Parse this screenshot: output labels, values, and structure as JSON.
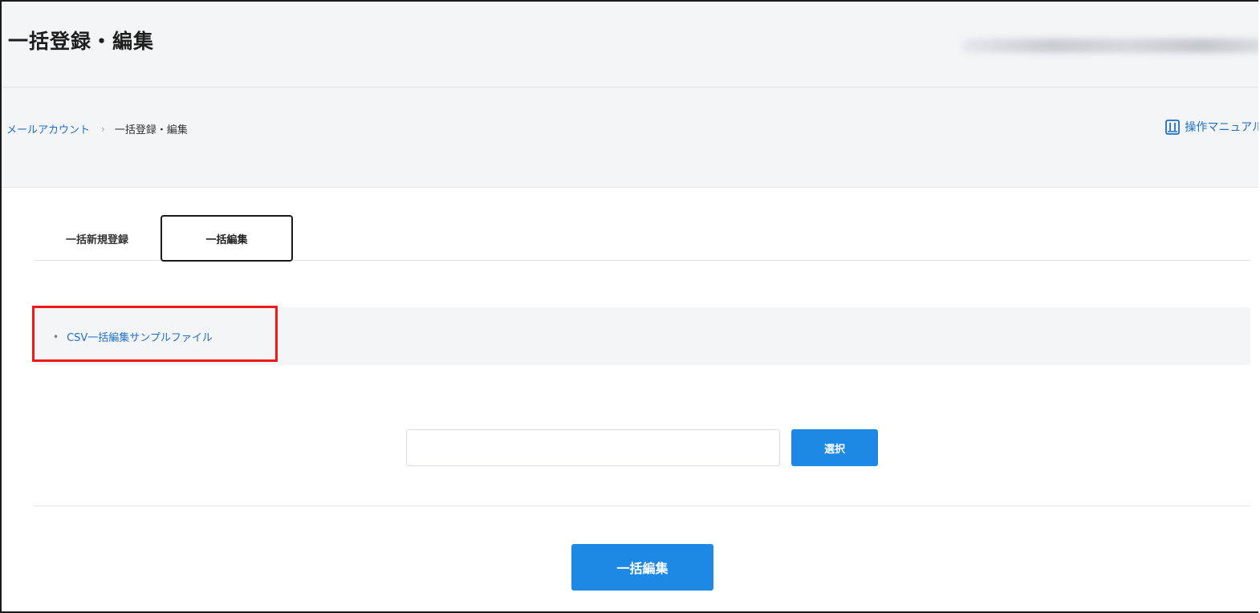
{
  "header": {
    "title": "一括登録・編集"
  },
  "breadcrumb": {
    "parent": "メールアカウント",
    "separator": "›",
    "current": "一括登録・編集"
  },
  "manual": {
    "icon": "book-icon",
    "label": "操作マニュアル"
  },
  "tabs": [
    {
      "label": "一括新規登録",
      "active": false
    },
    {
      "label": "一括編集",
      "active": true
    }
  ],
  "sample": {
    "bullet": "•",
    "link": "CSV一括編集サンプルファイル"
  },
  "file": {
    "value": "",
    "placeholder": "",
    "select_label": "選択"
  },
  "submit": {
    "label": "一括編集"
  },
  "colors": {
    "accent": "#1e88e5",
    "link": "#1e6fc8",
    "highlight": "#f01818",
    "panel_bg": "#f4f5f7"
  }
}
